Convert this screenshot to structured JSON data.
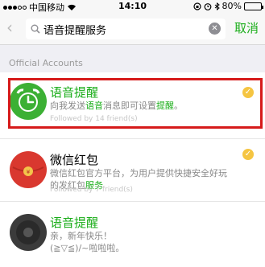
{
  "status_bar": {
    "carrier": "中国移动",
    "time": "14:10",
    "battery": "80%",
    "battery_level": 0.8
  },
  "search": {
    "back_icon": "chevron-left-icon",
    "query": "语音提醒服务",
    "clear_icon": "clear-icon",
    "cancel_label": "取消"
  },
  "section": {
    "title": "Official Accounts"
  },
  "results": [
    {
      "name": "语音提醒",
      "desc_parts": [
        "向我发送",
        "语音",
        "消息即可设置",
        "提醒",
        "。"
      ],
      "followers": "Followed by 14 friend(s)",
      "avatar_icon": "alarm-clock-icon",
      "badge_icon": "verified-badge-icon"
    },
    {
      "name": "微信红包",
      "desc_parts": [
        "微信红包官方平台，为用户提供快捷安全好玩的发红包",
        "服务"
      ],
      "followers": "Followed by 7 friend(s)",
      "avatar_icon": "red-packet-icon",
      "badge_icon": "verified-badge-icon"
    },
    {
      "name": "语音提醒",
      "desc_lines": [
        "亲，新年快乐！",
        "(≧▽≦)/~啦啦啦。"
      ],
      "avatar_icon": "dark-avatar-icon"
    }
  ],
  "colors": {
    "accent": "#1aad19",
    "highlight_border": "#d61a1a",
    "badge": "#f5c542"
  }
}
